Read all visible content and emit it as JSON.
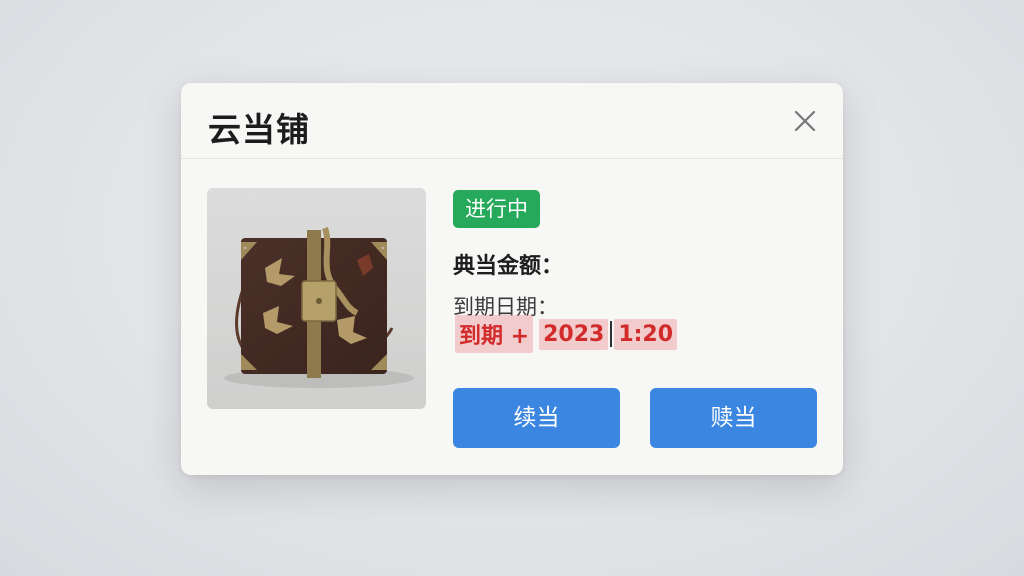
{
  "dialog": {
    "title": "云当铺",
    "close_icon": "close-icon"
  },
  "item": {
    "image_icon": "leather-bag-photo",
    "status": "进行中",
    "status_color": "#27a95b",
    "amount_label": "典当金额：",
    "due_label": "到期日期：",
    "due_value": {
      "part1": "到期 +",
      "part2": "2023",
      "part3": "1:20"
    }
  },
  "actions": {
    "renew_label": "续当",
    "redeem_label": "赎当",
    "button_color": "#3a86e0"
  },
  "colors": {
    "accent_red": "#d22b2b"
  }
}
